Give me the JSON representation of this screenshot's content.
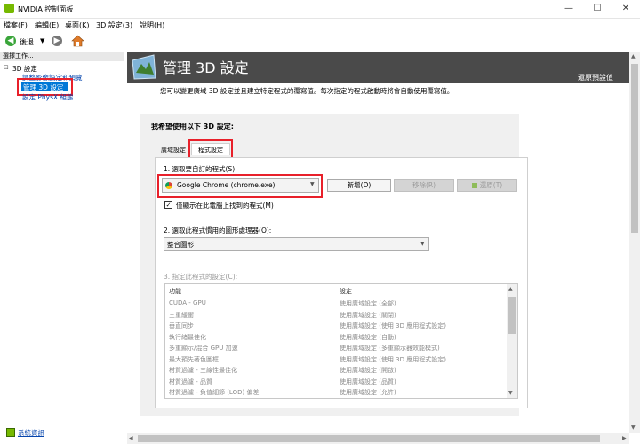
{
  "window": {
    "title": "NVIDIA 控制面板",
    "minimize": "—",
    "maximize": "☐",
    "close": "✕"
  },
  "menu": [
    "檔案(F)",
    "編輯(E)",
    "桌面(K)",
    "3D 設定(3)",
    "說明(H)"
  ],
  "toolbar": {
    "back_label": "後退"
  },
  "sidebar": {
    "header": "選擇工作...",
    "tree_root": "3D 設定",
    "items": [
      "調整影像設定和預覽",
      "管理 3D 設定",
      "設定 PhysX 組態"
    ],
    "system_info": "系統資訊"
  },
  "main": {
    "title": "管理 3D 設定",
    "restore": "還原預設值",
    "description": "您可以變更廣域 3D 設定並且建立特定程式的覆寫值。每次指定的程式啟動時將會自動使用覆寫值。",
    "heading": "我希望使用以下 3D 設定:",
    "tabs": [
      "廣域設定",
      "程式設定"
    ],
    "step1_label": "1. 選取要自訂的程式(S):",
    "program_value": "Google Chrome (chrome.exe)",
    "add_button": "新增(D)",
    "remove_button": "移除(R)",
    "restore_button": "還原(T)",
    "checkbox_label": "僅顯示在此電腦上找到的程式(M)",
    "checkbox_checked": "✓",
    "step2_label": "2. 選取此程式慣用的圖形處理器(O):",
    "gpu_value": "整合圖形",
    "step3_label": "3. 指定此程式的設定(C):",
    "table": {
      "headers": [
        "功能",
        "設定"
      ],
      "rows": [
        [
          "CUDA - GPU",
          "使用廣域設定 (全部)"
        ],
        [
          "三重緩衝",
          "使用廣域設定 (關閉)"
        ],
        [
          "垂直同步",
          "使用廣域設定 (使用 3D 應用程式設定)"
        ],
        [
          "執行緒最佳化",
          "使用廣域設定 (自動)"
        ],
        [
          "多重顯示/混合 GPU 加速",
          "使用廣域設定 (多重顯示器效能模式)"
        ],
        [
          "最大預先著色圖框",
          "使用廣域設定 (使用 3D 應用程式設定)"
        ],
        [
          "材質過濾 - 三線性最佳化",
          "使用廣域設定 (開啟)"
        ],
        [
          "材質過濾 - 品質",
          "使用廣域設定 (品質)"
        ],
        [
          "材質過濾 - 負值細節 (LOD) 偏差",
          "使用廣域設定 (允許)"
        ]
      ]
    }
  },
  "colors": {
    "highlight_border": "#e8202a",
    "selected_bg": "#0078d7",
    "nvidia_green": "#76b900",
    "banner": "#4a4a4a"
  }
}
